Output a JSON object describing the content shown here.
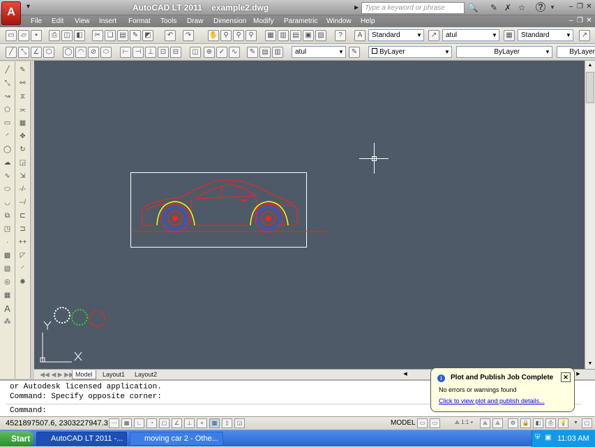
{
  "app": {
    "logo": "A",
    "title": "AutoCAD LT 2011",
    "document": "example2.dwg",
    "search_placeholder": "Type a keyword or phrase",
    "help": "?"
  },
  "menus": [
    "File",
    "Edit",
    "View",
    "Insert",
    "Format",
    "Tools",
    "Draw",
    "Dimension",
    "Modify",
    "Parametric",
    "Window",
    "Help"
  ],
  "toolbar1": {
    "text_style": "Standard",
    "dim_style": "atul",
    "table_style": "Standard"
  },
  "toolbar2": {
    "layer": "atul",
    "color": "ByLayer",
    "linetype": "ByLayer",
    "lineweight": "ByLayer"
  },
  "layout_tabs": [
    "Model",
    "Layout1",
    "Layout2"
  ],
  "command": {
    "line1": "or Autodesk licensed application.",
    "line2": "Command: Specify opposite corner:",
    "prompt": "Command:"
  },
  "status": {
    "coords": "4521897507.6, 2303227947.3",
    "model": "MODEL",
    "scale": "1:1"
  },
  "balloon": {
    "title": "Plot and Publish Job Complete",
    "body": "No errors or warnings found",
    "link": "Click to view plot and publish details..."
  },
  "taskbar": {
    "start": "Start",
    "tasks": [
      "AutoCAD LT 2011 -...",
      "moving car 2 - Othe..."
    ],
    "clock": "11:03 AM"
  },
  "colors": {
    "canvas": "#4e5a67",
    "car": "#ff2020",
    "wheel_rim": "#ffff00",
    "wheel_ring": "#3050ff",
    "ucs": "#ffffff"
  },
  "icons": {
    "search": "search-icon",
    "help": "help-icon",
    "star": "star-icon",
    "close": "close-icon"
  }
}
